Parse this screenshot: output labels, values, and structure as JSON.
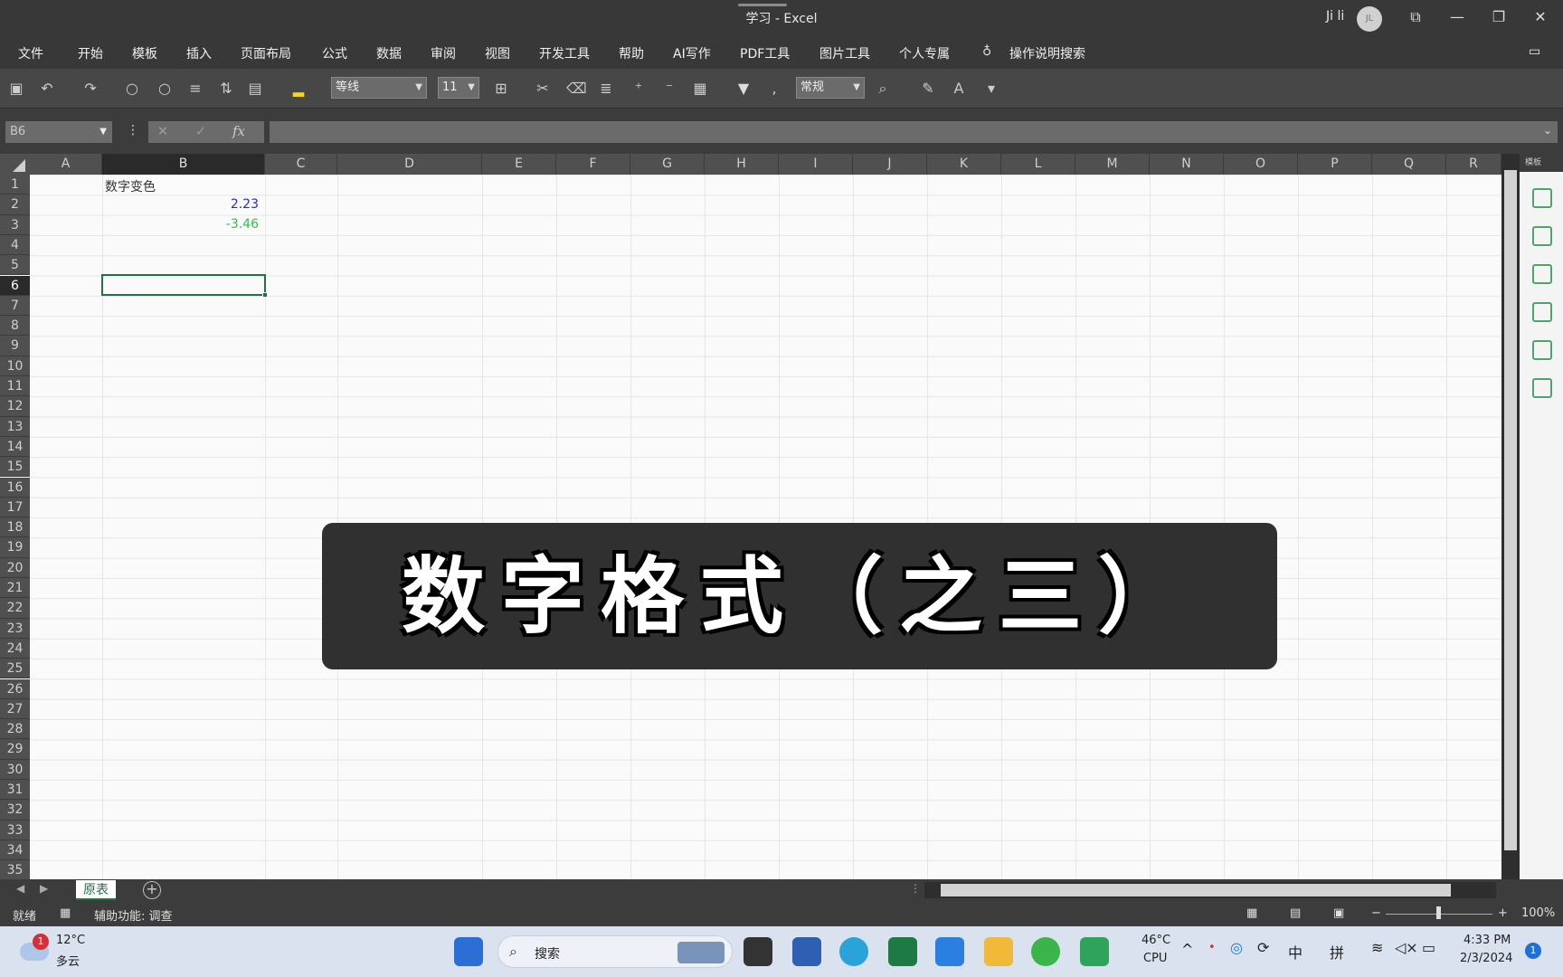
{
  "window": {
    "title": "学习  -  Excel",
    "user": "Ji li",
    "avatar_initials": "JL"
  },
  "menu": [
    "文件",
    "开始",
    "模板",
    "插入",
    "页面布局",
    "公式",
    "数据",
    "审阅",
    "视图",
    "开发工具",
    "帮助",
    "AI写作",
    "PDF工具",
    "图片工具",
    "个人专属",
    "操作说明搜索"
  ],
  "toolbar": {
    "font_name": "等线",
    "font_size": "11",
    "number_format": "常规"
  },
  "formula_bar": {
    "name_box": "B6",
    "fx_label": "fx",
    "formula": ""
  },
  "columns": [
    "A",
    "B",
    "C",
    "D",
    "E",
    "F",
    "G",
    "H",
    "I",
    "J",
    "K",
    "L",
    "M",
    "N",
    "O",
    "P",
    "Q",
    "R"
  ],
  "selected_column": "B",
  "selected_row": "6",
  "cells": {
    "B1": "数字变色",
    "B2": "2.23",
    "B3": "-3.46"
  },
  "colors": {
    "positive_value": "#2a2ad0",
    "negative_value": "#31c24a",
    "accent": "#217346"
  },
  "sheet_tabs": [
    "原表"
  ],
  "status": {
    "ready": "就绪",
    "accessibility": "辅助功能: 调查",
    "zoom": "100%"
  },
  "side_panel": {
    "header": "模板"
  },
  "taskbar": {
    "weather_temp": "12°C",
    "weather_desc": "多云",
    "notification_count": "1",
    "search_placeholder": "搜索",
    "cpu_temp": "46°C",
    "cpu_label": "CPU",
    "ime_lang": "中",
    "ime_mode": "拼",
    "time": "4:33 PM",
    "date": "2/3/2024"
  },
  "overlay_title": "数字格式（之三）"
}
